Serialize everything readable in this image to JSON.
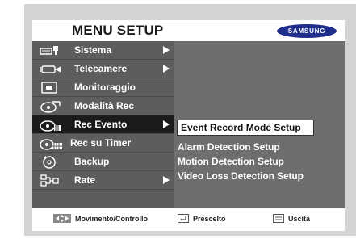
{
  "header": {
    "title": "MENU SETUP",
    "brand": "SAMSUNG"
  },
  "menu": {
    "items": [
      {
        "label": "Sistema",
        "icon": "system-icon",
        "has_submenu": true
      },
      {
        "label": "Telecamere",
        "icon": "camera-icon",
        "has_submenu": true
      },
      {
        "label": "Monitoraggio",
        "icon": "monitor-icon",
        "has_submenu": false
      },
      {
        "label": "Modalità Rec",
        "icon": "record-mode-icon",
        "has_submenu": false
      },
      {
        "label": "Rec Evento",
        "icon": "event-record-icon",
        "has_submenu": true,
        "selected": true
      },
      {
        "label": "Rec su Timer",
        "icon": "timer-record-icon",
        "has_submenu": false
      },
      {
        "label": "Backup",
        "icon": "backup-icon",
        "has_submenu": false
      },
      {
        "label": "Rate",
        "icon": "network-icon",
        "has_submenu": true
      }
    ]
  },
  "submenu": {
    "items": [
      {
        "label": "Event Record Mode Setup",
        "selected": true
      },
      {
        "label": "Alarm Detection Setup"
      },
      {
        "label": "Motion Detection Setup"
      },
      {
        "label": "Video Loss Detection Setup"
      }
    ]
  },
  "footer": {
    "move": "Movimento/Controllo",
    "select": "Prescelto",
    "exit": "Uscita"
  },
  "colors": {
    "menu_bg": "#5d5d5d",
    "panel_bg": "#6e6e6e",
    "selected_bg": "#1b1b1b",
    "frame": "#d4d4d4",
    "brand": "#1f2f8a"
  }
}
